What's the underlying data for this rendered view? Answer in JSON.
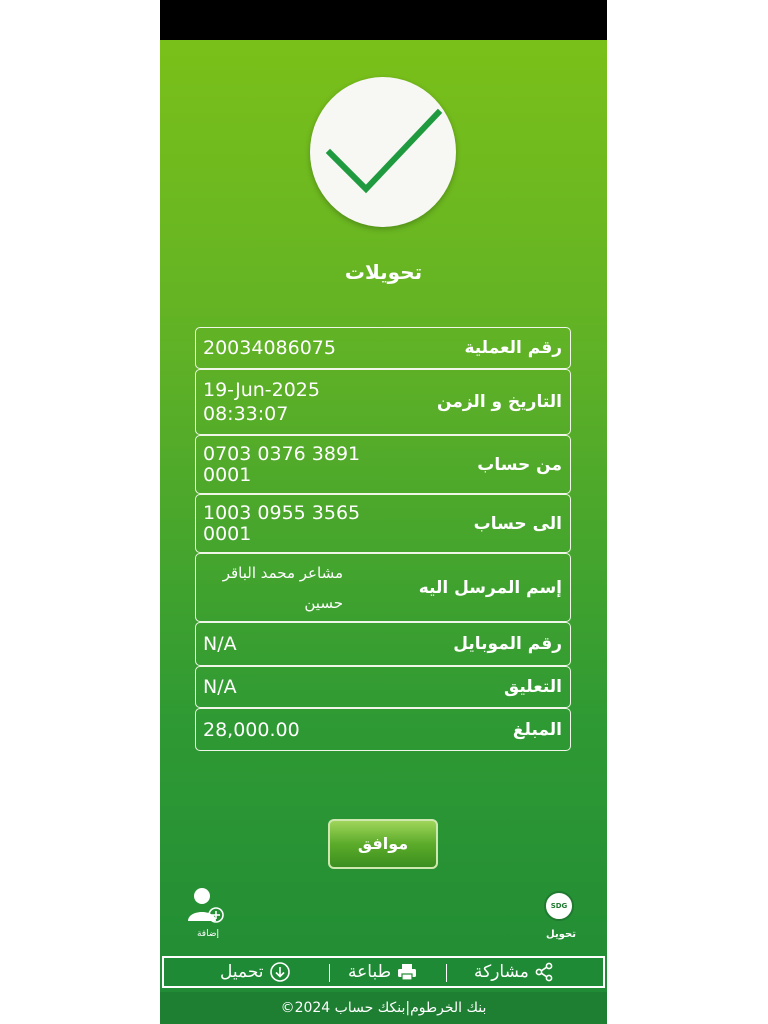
{
  "title": "تحويلات",
  "fields": [
    {
      "label": "رقم العملية",
      "value": "20034086075"
    },
    {
      "label": "التاريخ و الزمن",
      "value": "19-Jun-2025\n08:33:07"
    },
    {
      "label": "من حساب",
      "value": "0703 0376 3891\n0001"
    },
    {
      "label": "الى حساب",
      "value": "1003 0955 3565\n0001"
    },
    {
      "label": "إسم المرسل اليه",
      "value": "مشاعر محمد الباقر\nحسين"
    },
    {
      "label": "رقم الموبايل",
      "value": "N/A"
    },
    {
      "label": "التعليق",
      "value": "N/A"
    },
    {
      "label": "المبلغ",
      "value": "28,000.00"
    }
  ],
  "ok_button": "موافق",
  "add_user_caption": "إضافة",
  "sdg": {
    "badge": "SDG",
    "caption": "تحويل"
  },
  "actions": {
    "share": "مشاركة",
    "print": "طباعة",
    "download": "تحميل"
  },
  "footer": "©2024 بنك الخرطوم|بنكك حساب",
  "colors": {
    "check": "#1f9a3e",
    "gradient_top": "#7ec218",
    "gradient_bottom": "#1f8a35"
  },
  "icons": [
    "check-icon",
    "add-user-icon",
    "sdg-currency-icon",
    "share-icon",
    "print-icon",
    "download-icon"
  ]
}
